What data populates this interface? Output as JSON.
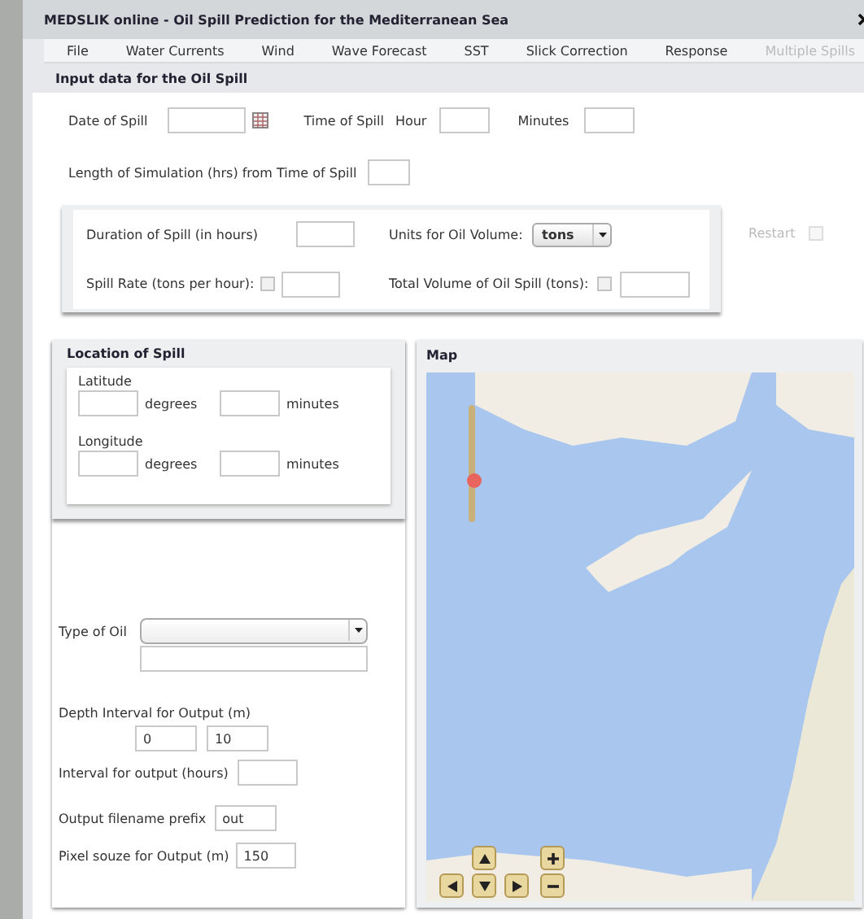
{
  "window": {
    "title": "MEDSLIK online - Oil Spill Prediction for the Mediterranean Sea"
  },
  "menu": [
    {
      "label": "File",
      "disabled": false
    },
    {
      "label": "Water Currents",
      "disabled": false
    },
    {
      "label": "Wind",
      "disabled": false
    },
    {
      "label": "Wave Forecast",
      "disabled": false
    },
    {
      "label": "SST",
      "disabled": false
    },
    {
      "label": "Slick Correction",
      "disabled": false
    },
    {
      "label": "Response",
      "disabled": false
    },
    {
      "label": "Multiple Spills",
      "disabled": true
    }
  ],
  "section_title": "Input data for the Oil Spill",
  "date_row": {
    "date_label": "Date of Spill",
    "time_label": "Time of Spill",
    "hour_label": "Hour",
    "minutes_label": "Minutes"
  },
  "simulation_length": {
    "label": "Length of Simulation (hrs) from Time of Spill"
  },
  "volume_box": {
    "duration_label": "Duration of Spill (in hours)",
    "units_label": "Units for Oil Volume:",
    "units_value": "tons",
    "rate_label": "Spill Rate (tons per hour):",
    "rate_checked": false,
    "total_label": "Total Volume of Oil Spill (tons):",
    "total_checked": false
  },
  "restart": {
    "label": "Restart",
    "disabled": true,
    "checked": false
  },
  "location": {
    "title": "Location of Spill",
    "fields": [
      {
        "label": "Latitude",
        "degrees_unit": "degrees",
        "minutes_unit": "minutes"
      },
      {
        "label": "Longitude",
        "degrees_unit": "degrees",
        "minutes_unit": "minutes"
      }
    ]
  },
  "oil_type": {
    "label": "Type of Oil"
  },
  "depth": {
    "label": "Depth Interval for Output (m)",
    "from": "0",
    "to": "10"
  },
  "output_interval": {
    "label": "Interval for output (hours)"
  },
  "prefix": {
    "label": "Output filename prefix",
    "value": "out"
  },
  "pixel_size": {
    "label": "Pixel souze for Output (m)",
    "value": "150"
  },
  "map": {
    "title": "Map",
    "zoom_slider": {
      "level": 0.35
    }
  }
}
